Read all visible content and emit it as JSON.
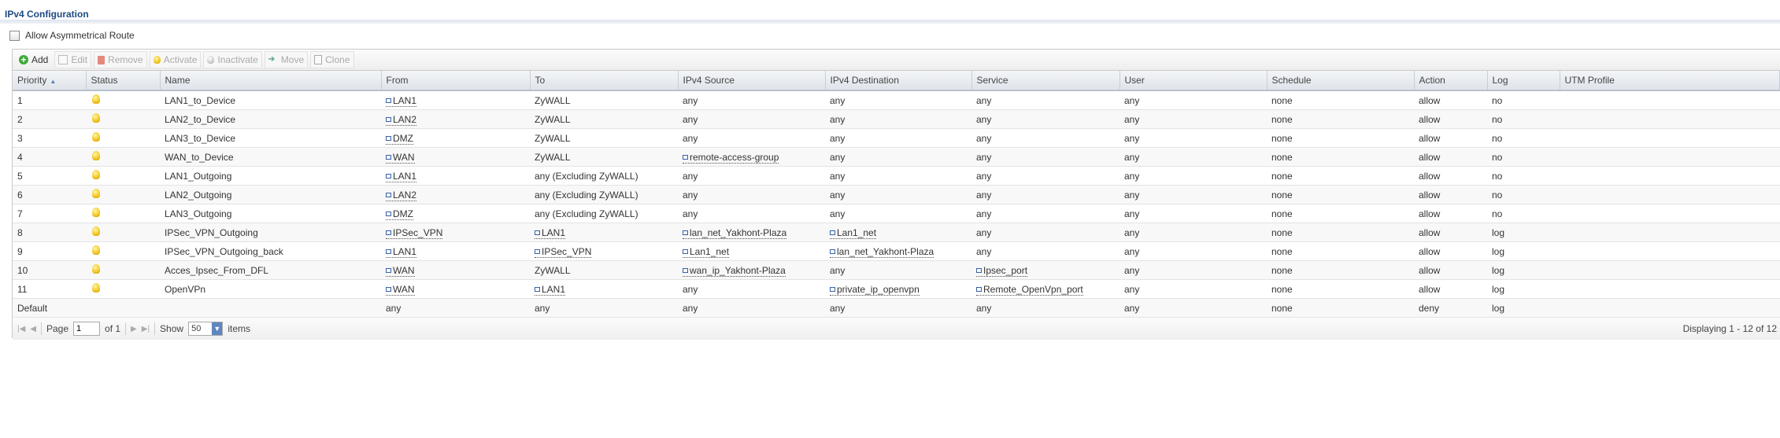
{
  "title": "IPv4 Configuration",
  "allow_asymmetrical_route": {
    "label": "Allow Asymmetrical Route",
    "checked": false
  },
  "toolbar": {
    "add": "Add",
    "edit": "Edit",
    "remove": "Remove",
    "activate": "Activate",
    "inactivate": "Inactivate",
    "move": "Move",
    "clone": "Clone"
  },
  "columns": [
    "Priority",
    "Status",
    "Name",
    "From",
    "To",
    "IPv4 Source",
    "IPv4 Destination",
    "Service",
    "User",
    "Schedule",
    "Action",
    "Log",
    "UTM Profile"
  ],
  "rows": [
    {
      "priority": "1",
      "name": "LAN1_to_Device",
      "from": "LAN1",
      "to": "ZyWALL",
      "src": "any",
      "dst": "any",
      "service": "any",
      "user": "any",
      "schedule": "none",
      "action": "allow",
      "log": "no",
      "utm": ""
    },
    {
      "priority": "2",
      "name": "LAN2_to_Device",
      "from": "LAN2",
      "to": "ZyWALL",
      "src": "any",
      "dst": "any",
      "service": "any",
      "user": "any",
      "schedule": "none",
      "action": "allow",
      "log": "no",
      "utm": ""
    },
    {
      "priority": "3",
      "name": "LAN3_to_Device",
      "from": "DMZ",
      "to": "ZyWALL",
      "src": "any",
      "dst": "any",
      "service": "any",
      "user": "any",
      "schedule": "none",
      "action": "allow",
      "log": "no",
      "utm": ""
    },
    {
      "priority": "4",
      "name": "WAN_to_Device",
      "from": "WAN",
      "to": "ZyWALL",
      "src": "remote-access-group",
      "dst": "any",
      "service": "any",
      "user": "any",
      "schedule": "none",
      "action": "allow",
      "log": "no",
      "utm": ""
    },
    {
      "priority": "5",
      "name": "LAN1_Outgoing",
      "from": "LAN1",
      "to": "any (Excluding ZyWALL)",
      "src": "any",
      "dst": "any",
      "service": "any",
      "user": "any",
      "schedule": "none",
      "action": "allow",
      "log": "no",
      "utm": ""
    },
    {
      "priority": "6",
      "name": "LAN2_Outgoing",
      "from": "LAN2",
      "to": "any (Excluding ZyWALL)",
      "src": "any",
      "dst": "any",
      "service": "any",
      "user": "any",
      "schedule": "none",
      "action": "allow",
      "log": "no",
      "utm": ""
    },
    {
      "priority": "7",
      "name": "LAN3_Outgoing",
      "from": "DMZ",
      "to": "any (Excluding ZyWALL)",
      "src": "any",
      "dst": "any",
      "service": "any",
      "user": "any",
      "schedule": "none",
      "action": "allow",
      "log": "no",
      "utm": ""
    },
    {
      "priority": "8",
      "name": "IPSec_VPN_Outgoing",
      "from": "IPSec_VPN",
      "to": "LAN1",
      "src": "lan_net_Yakhont-Plaza",
      "dst": "Lan1_net",
      "service": "any",
      "user": "any",
      "schedule": "none",
      "action": "allow",
      "log": "log",
      "utm": ""
    },
    {
      "priority": "9",
      "name": "IPSec_VPN_Outgoing_back",
      "from": "LAN1",
      "to": "IPSec_VPN",
      "src": "Lan1_net",
      "dst": "lan_net_Yakhont-Plaza",
      "service": "any",
      "user": "any",
      "schedule": "none",
      "action": "allow",
      "log": "log",
      "utm": ""
    },
    {
      "priority": "10",
      "name": "Acces_Ipsec_From_DFL",
      "from": "WAN",
      "to": "ZyWALL",
      "src": "wan_ip_Yakhont-Plaza",
      "dst": "any",
      "service": "Ipsec_port",
      "user": "any",
      "schedule": "none",
      "action": "allow",
      "log": "log",
      "utm": ""
    },
    {
      "priority": "11",
      "name": "OpenVPn",
      "from": "WAN",
      "to": "LAN1",
      "src": "any",
      "dst": "private_ip_openvpn",
      "service": "Remote_OpenVpn_port",
      "user": "any",
      "schedule": "none",
      "action": "allow",
      "log": "log",
      "utm": ""
    }
  ],
  "default_row": {
    "priority": "Default",
    "from": "any",
    "to": "any",
    "src": "any",
    "dst": "any",
    "service": "any",
    "user": "any",
    "schedule": "none",
    "action": "deny",
    "log": "log"
  },
  "links": {
    "from": [
      "LAN1",
      "LAN2",
      "DMZ",
      "WAN",
      "LAN1",
      "LAN2",
      "DMZ",
      "IPSec_VPN",
      "LAN1",
      "WAN",
      "WAN"
    ],
    "to": [
      false,
      false,
      false,
      false,
      false,
      false,
      false,
      true,
      true,
      false,
      true
    ],
    "src": [
      false,
      false,
      false,
      true,
      false,
      false,
      false,
      true,
      true,
      true,
      false
    ],
    "dst": [
      false,
      false,
      false,
      false,
      false,
      false,
      false,
      true,
      true,
      false,
      true
    ],
    "service": [
      false,
      false,
      false,
      false,
      false,
      false,
      false,
      false,
      false,
      true,
      true
    ]
  },
  "pager": {
    "page_label": "Page",
    "page": "1",
    "of_label": "of 1",
    "show_label": "Show",
    "page_size": "50",
    "items_label": "items",
    "displaying": "Displaying 1 - 12 of 12"
  }
}
